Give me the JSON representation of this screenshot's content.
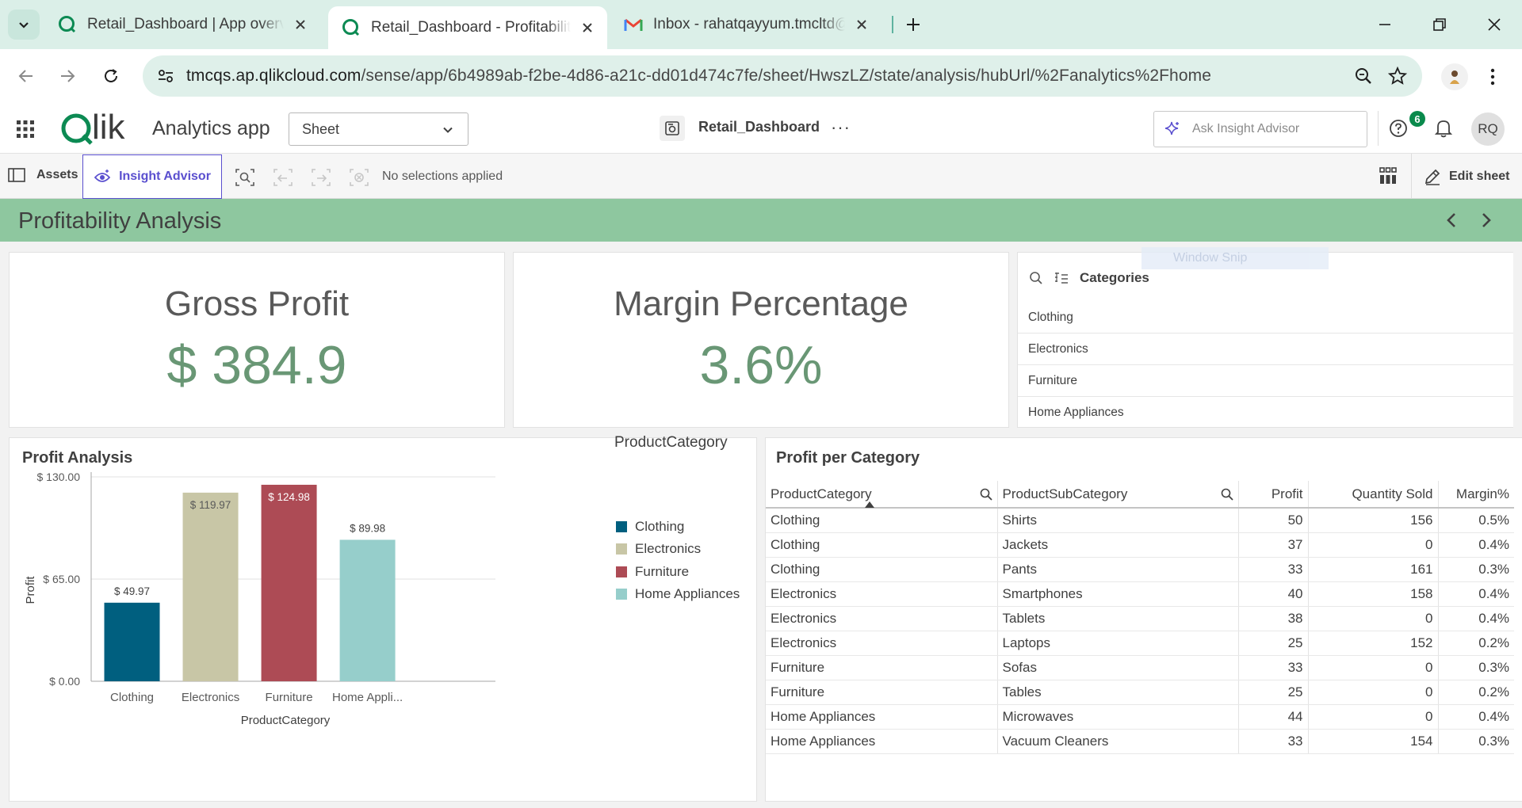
{
  "browser": {
    "tabs": [
      {
        "title": "Retail_Dashboard | App overview",
        "icon": "qlik-icon",
        "active": false
      },
      {
        "title": "Retail_Dashboard - Profitability",
        "icon": "qlik-icon",
        "active": true
      },
      {
        "title": "Inbox - rahatqayyum.tmcltd@gmail.com",
        "icon": "gmail-icon",
        "active": false
      }
    ],
    "url_host": "tmcqs.ap.qlikcloud.com",
    "url_path": "/sense/app/6b4989ab-f2be-4d86-a21c-dd01d474c7fe/sheet/HwszLZ/state/analysis/hubUrl/%2Fanalytics%2Fhome"
  },
  "header": {
    "logo": "Qlik",
    "app_name": "Analytics app",
    "view_select": "Sheet",
    "doc_title": "Retail_Dashboard",
    "more": "···",
    "insight_placeholder": "Ask Insight Advisor",
    "help_badge": "6",
    "user_initials": "RQ"
  },
  "toolbar": {
    "assets": "Assets",
    "insight_advisor": "Insight Advisor",
    "no_selections": "No selections applied",
    "edit_sheet": "Edit sheet"
  },
  "sheet": {
    "title": "Profitability Analysis"
  },
  "overlay": {
    "window_snip": "Window Snip"
  },
  "kpis": [
    {
      "title": "Gross Profit",
      "value": "$ 384.9"
    },
    {
      "title": "Margin Percentage",
      "value": "3.6%"
    }
  ],
  "filter": {
    "title": "Categories",
    "items": [
      "Clothing",
      "Electronics",
      "Furniture",
      "Home Appliances"
    ]
  },
  "chart": {
    "title": "Profit Analysis",
    "legend_title": "ProductCategory",
    "legend": [
      {
        "label": "Clothing",
        "color": "#005f7f"
      },
      {
        "label": "Electronics",
        "color": "#c8c6a6"
      },
      {
        "label": "Furniture",
        "color": "#ad4b55"
      },
      {
        "label": "Home Appliances",
        "color": "#96cecb"
      }
    ]
  },
  "chart_data": {
    "type": "bar",
    "title": "Profit Analysis",
    "xlabel": "ProductCategory",
    "ylabel": "Profit",
    "categories": [
      "Clothing",
      "Electronics",
      "Furniture",
      "Home Appli..."
    ],
    "values": [
      49.97,
      119.97,
      124.98,
      89.98
    ],
    "value_labels": [
      "$ 49.97",
      "$ 119.97",
      "$ 124.98",
      "$ 89.98"
    ],
    "colors": [
      "#005f7f",
      "#c8c6a6",
      "#ad4b55",
      "#96cecb"
    ],
    "yticks": [
      0,
      65,
      130
    ],
    "ytick_labels": [
      "$ 0.00",
      "$ 65.00",
      "$ 130.00"
    ],
    "ylim": [
      0,
      130
    ],
    "grid": true,
    "legend_position": "right"
  },
  "table": {
    "title": "Profit per Category",
    "columns": [
      "ProductCategory",
      "ProductSubCategory",
      "Profit",
      "Quantity Sold",
      "Margin%"
    ],
    "rows": [
      [
        "Clothing",
        "Shirts",
        "50",
        "156",
        "0.5%"
      ],
      [
        "Clothing",
        "Jackets",
        "37",
        "0",
        "0.4%"
      ],
      [
        "Clothing",
        "Pants",
        "33",
        "161",
        "0.3%"
      ],
      [
        "Electronics",
        "Smartphones",
        "40",
        "158",
        "0.4%"
      ],
      [
        "Electronics",
        "Tablets",
        "38",
        "0",
        "0.4%"
      ],
      [
        "Electronics",
        "Laptops",
        "25",
        "152",
        "0.2%"
      ],
      [
        "Furniture",
        "Sofas",
        "33",
        "0",
        "0.3%"
      ],
      [
        "Furniture",
        "Tables",
        "25",
        "0",
        "0.2%"
      ],
      [
        "Home Appliances",
        "Microwaves",
        "44",
        "0",
        "0.4%"
      ],
      [
        "Home Appliances",
        "Vacuum Cleaners",
        "33",
        "154",
        "0.3%"
      ]
    ]
  }
}
